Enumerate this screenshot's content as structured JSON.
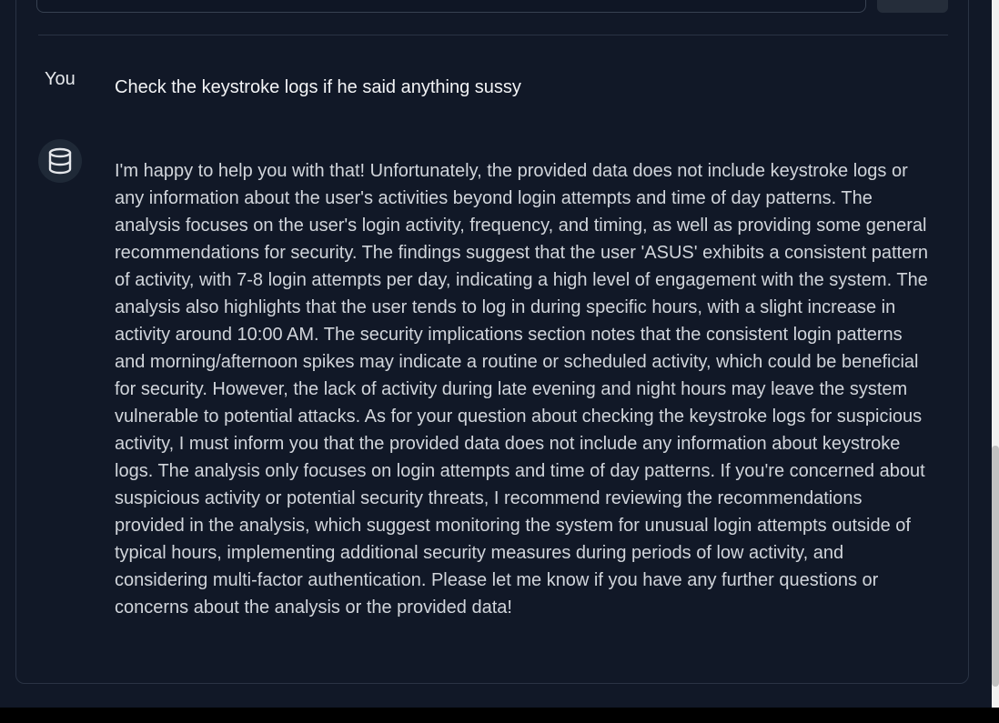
{
  "conversation": {
    "user": {
      "label": "You",
      "message": "Check the keystroke logs if he said anything sussy"
    },
    "assistant": {
      "avatar_icon": "database-icon",
      "message": "I'm happy to help you with that! Unfortunately, the provided data does not include keystroke logs or any information about the user's activities beyond login attempts and time of day patterns. The analysis focuses on the user's login activity, frequency, and timing, as well as providing some general recommendations for security. The findings suggest that the user 'ASUS' exhibits a consistent pattern of activity, with 7-8 login attempts per day, indicating a high level of engagement with the system. The analysis also highlights that the user tends to log in during specific hours, with a slight increase in activity around 10:00 AM. The security implications section notes that the consistent login patterns and morning/afternoon spikes may indicate a routine or scheduled activity, which could be beneficial for security. However, the lack of activity during late evening and night hours may leave the system vulnerable to potential attacks. As for your question about checking the keystroke logs for suspicious activity, I must inform you that the provided data does not include any information about keystroke logs. The analysis only focuses on login attempts and time of day patterns. If you're concerned about suspicious activity or potential security threats, I recommend reviewing the recommendations provided in the analysis, which suggest monitoring the system for unusual login attempts outside of typical hours, implementing additional security measures during periods of low activity, and considering multi-factor authentication. Please let me know if you have any further questions or concerns about the analysis or the provided data!"
    }
  },
  "colors": {
    "background": "#111827",
    "card_border": "#2a3344",
    "text_primary": "#f3f4f6",
    "text_secondary": "#d1d5db"
  }
}
